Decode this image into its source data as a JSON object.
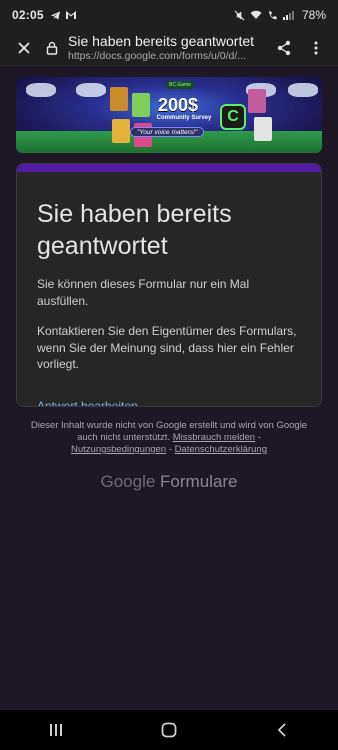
{
  "status_bar": {
    "time": "02:05",
    "battery": "78%"
  },
  "browser": {
    "page_title": "Sie haben bereits geantwortet",
    "url": "https://docs.google.com/forms/u/0/d/..."
  },
  "banner": {
    "amount": "200$",
    "subtitle": "Community Survey",
    "tagline": "\"Your voice matters!\"",
    "tag": "BC.Game"
  },
  "form": {
    "heading": "Sie haben bereits geantwortet",
    "message": "Sie können dieses Formular nur ein Mal ausfüllen.",
    "contact": "Kontaktieren Sie den Eigentümer des Formulars, wenn Sie der Meinung sind, dass hier ein Fehler vorliegt.",
    "edit_link": "Antwort bearbeiten"
  },
  "footer": {
    "disclaimer": "Dieser Inhalt wurde nicht von Google erstellt und wird von Google auch nicht unterstützt.",
    "abuse_link": "Missbrauch melden",
    "sep1": " - ",
    "terms_link": "Nutzungsbedingungen",
    "sep2": " - ",
    "privacy_link": "Datenschutzerklärung"
  },
  "brand": {
    "google": "Google",
    "product": "Formulare"
  },
  "colors": {
    "background": "#1e1726",
    "accent": "#4e1aa6",
    "link": "#7fb0e6"
  },
  "icons": {
    "close": "close-icon",
    "lock": "lock-icon",
    "share": "share-icon",
    "menu": "more-vert-icon"
  }
}
